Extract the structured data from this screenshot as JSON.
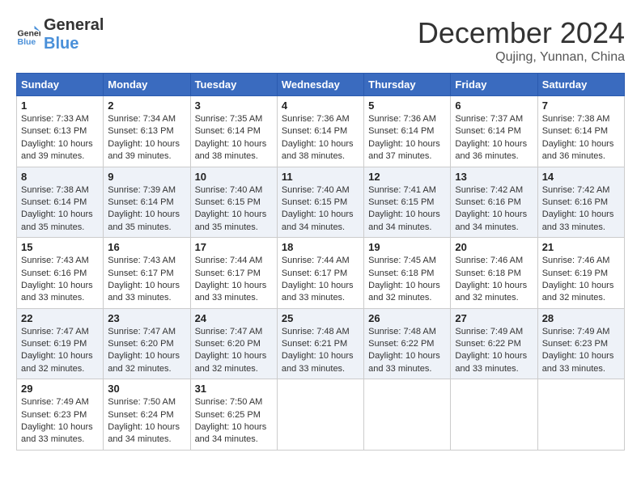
{
  "header": {
    "logo_general": "General",
    "logo_blue": "Blue",
    "month_title": "December 2024",
    "location": "Qujing, Yunnan, China"
  },
  "weekdays": [
    "Sunday",
    "Monday",
    "Tuesday",
    "Wednesday",
    "Thursday",
    "Friday",
    "Saturday"
  ],
  "weeks": [
    [
      {
        "day": "1",
        "sunrise": "7:33 AM",
        "sunset": "6:13 PM",
        "daylight": "10 hours and 39 minutes."
      },
      {
        "day": "2",
        "sunrise": "7:34 AM",
        "sunset": "6:13 PM",
        "daylight": "10 hours and 39 minutes."
      },
      {
        "day": "3",
        "sunrise": "7:35 AM",
        "sunset": "6:14 PM",
        "daylight": "10 hours and 38 minutes."
      },
      {
        "day": "4",
        "sunrise": "7:36 AM",
        "sunset": "6:14 PM",
        "daylight": "10 hours and 38 minutes."
      },
      {
        "day": "5",
        "sunrise": "7:36 AM",
        "sunset": "6:14 PM",
        "daylight": "10 hours and 37 minutes."
      },
      {
        "day": "6",
        "sunrise": "7:37 AM",
        "sunset": "6:14 PM",
        "daylight": "10 hours and 36 minutes."
      },
      {
        "day": "7",
        "sunrise": "7:38 AM",
        "sunset": "6:14 PM",
        "daylight": "10 hours and 36 minutes."
      }
    ],
    [
      {
        "day": "8",
        "sunrise": "7:38 AM",
        "sunset": "6:14 PM",
        "daylight": "10 hours and 35 minutes."
      },
      {
        "day": "9",
        "sunrise": "7:39 AM",
        "sunset": "6:14 PM",
        "daylight": "10 hours and 35 minutes."
      },
      {
        "day": "10",
        "sunrise": "7:40 AM",
        "sunset": "6:15 PM",
        "daylight": "10 hours and 35 minutes."
      },
      {
        "day": "11",
        "sunrise": "7:40 AM",
        "sunset": "6:15 PM",
        "daylight": "10 hours and 34 minutes."
      },
      {
        "day": "12",
        "sunrise": "7:41 AM",
        "sunset": "6:15 PM",
        "daylight": "10 hours and 34 minutes."
      },
      {
        "day": "13",
        "sunrise": "7:42 AM",
        "sunset": "6:16 PM",
        "daylight": "10 hours and 34 minutes."
      },
      {
        "day": "14",
        "sunrise": "7:42 AM",
        "sunset": "6:16 PM",
        "daylight": "10 hours and 33 minutes."
      }
    ],
    [
      {
        "day": "15",
        "sunrise": "7:43 AM",
        "sunset": "6:16 PM",
        "daylight": "10 hours and 33 minutes."
      },
      {
        "day": "16",
        "sunrise": "7:43 AM",
        "sunset": "6:17 PM",
        "daylight": "10 hours and 33 minutes."
      },
      {
        "day": "17",
        "sunrise": "7:44 AM",
        "sunset": "6:17 PM",
        "daylight": "10 hours and 33 minutes."
      },
      {
        "day": "18",
        "sunrise": "7:44 AM",
        "sunset": "6:17 PM",
        "daylight": "10 hours and 33 minutes."
      },
      {
        "day": "19",
        "sunrise": "7:45 AM",
        "sunset": "6:18 PM",
        "daylight": "10 hours and 32 minutes."
      },
      {
        "day": "20",
        "sunrise": "7:46 AM",
        "sunset": "6:18 PM",
        "daylight": "10 hours and 32 minutes."
      },
      {
        "day": "21",
        "sunrise": "7:46 AM",
        "sunset": "6:19 PM",
        "daylight": "10 hours and 32 minutes."
      }
    ],
    [
      {
        "day": "22",
        "sunrise": "7:47 AM",
        "sunset": "6:19 PM",
        "daylight": "10 hours and 32 minutes."
      },
      {
        "day": "23",
        "sunrise": "7:47 AM",
        "sunset": "6:20 PM",
        "daylight": "10 hours and 32 minutes."
      },
      {
        "day": "24",
        "sunrise": "7:47 AM",
        "sunset": "6:20 PM",
        "daylight": "10 hours and 32 minutes."
      },
      {
        "day": "25",
        "sunrise": "7:48 AM",
        "sunset": "6:21 PM",
        "daylight": "10 hours and 33 minutes."
      },
      {
        "day": "26",
        "sunrise": "7:48 AM",
        "sunset": "6:22 PM",
        "daylight": "10 hours and 33 minutes."
      },
      {
        "day": "27",
        "sunrise": "7:49 AM",
        "sunset": "6:22 PM",
        "daylight": "10 hours and 33 minutes."
      },
      {
        "day": "28",
        "sunrise": "7:49 AM",
        "sunset": "6:23 PM",
        "daylight": "10 hours and 33 minutes."
      }
    ],
    [
      {
        "day": "29",
        "sunrise": "7:49 AM",
        "sunset": "6:23 PM",
        "daylight": "10 hours and 33 minutes."
      },
      {
        "day": "30",
        "sunrise": "7:50 AM",
        "sunset": "6:24 PM",
        "daylight": "10 hours and 34 minutes."
      },
      {
        "day": "31",
        "sunrise": "7:50 AM",
        "sunset": "6:25 PM",
        "daylight": "10 hours and 34 minutes."
      },
      null,
      null,
      null,
      null
    ]
  ],
  "labels": {
    "sunrise": "Sunrise:",
    "sunset": "Sunset:",
    "daylight": "Daylight:"
  }
}
